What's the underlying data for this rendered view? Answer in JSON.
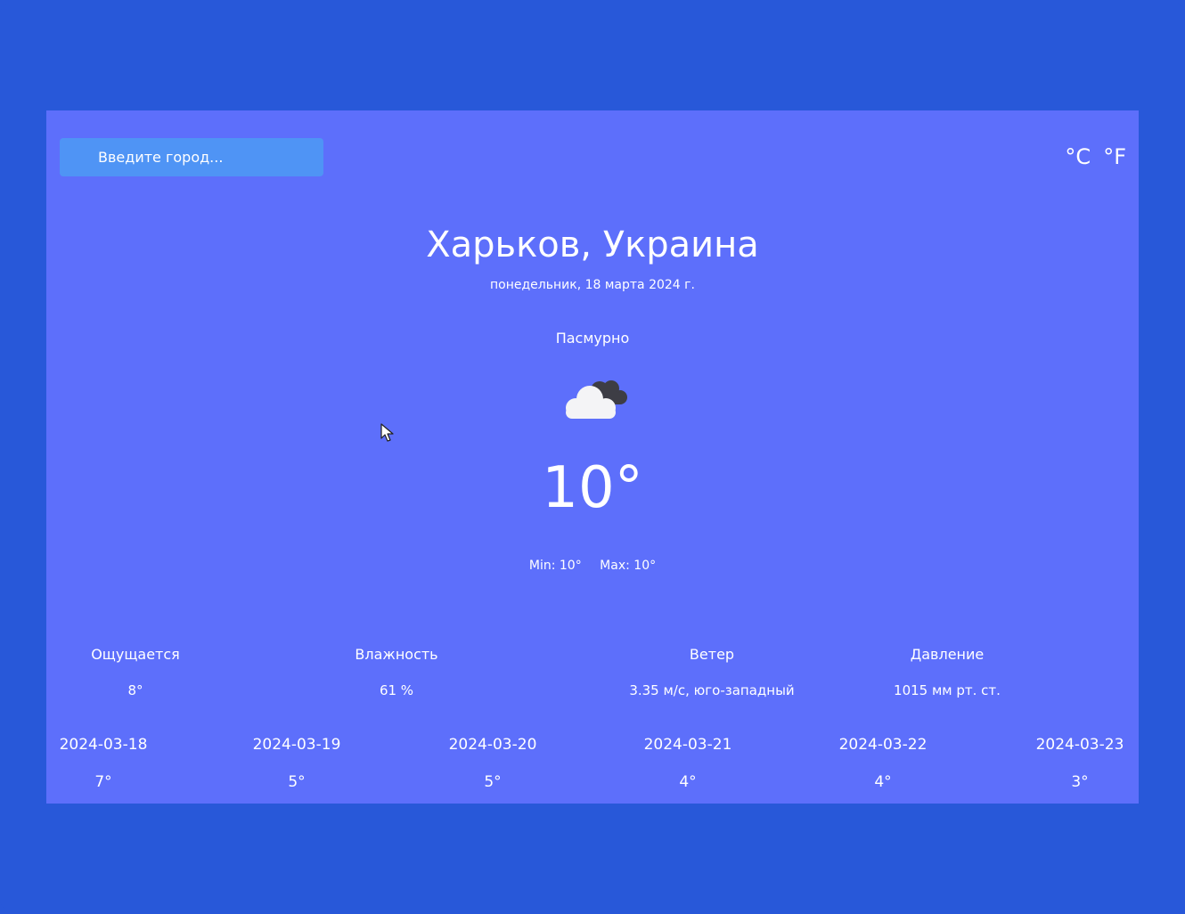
{
  "search": {
    "placeholder": "Введите город..."
  },
  "units": {
    "celsius": "°C",
    "fahrenheit": "°F"
  },
  "location": {
    "city": "Харьков, Украина",
    "date": "понедельник, 18 марта 2024 г."
  },
  "current": {
    "condition": "Пасмурно",
    "icon": "cloud-icon",
    "temperature": "10°",
    "min": "Min: 10°",
    "max": "Max: 10°"
  },
  "details": {
    "feels_like": {
      "label": "Ощущается",
      "value": "8°"
    },
    "humidity": {
      "label": "Влажность",
      "value": "61 %"
    },
    "wind": {
      "label": "Ветер",
      "value": "3.35 м/с, юго-западный"
    },
    "pressure": {
      "label": "Давление",
      "value": "1015 мм рт. ст."
    }
  },
  "forecast": [
    {
      "date": "2024-03-18",
      "temp": "7°"
    },
    {
      "date": "2024-03-19",
      "temp": "5°"
    },
    {
      "date": "2024-03-20",
      "temp": "5°"
    },
    {
      "date": "2024-03-21",
      "temp": "4°"
    },
    {
      "date": "2024-03-22",
      "temp": "4°"
    },
    {
      "date": "2024-03-23",
      "temp": "3°"
    }
  ],
  "colors": {
    "background": "#2858d9",
    "panel": "#5d6ffb",
    "search": "#4f94f5"
  }
}
